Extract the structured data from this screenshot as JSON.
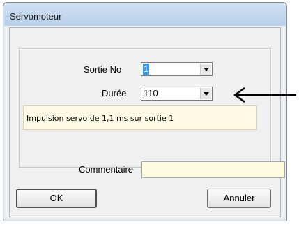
{
  "window": {
    "title": "Servomoteur"
  },
  "form": {
    "sortie_label": "Sortie No",
    "sortie_value": "1",
    "duree_label": "Durée",
    "duree_value": "110",
    "info_text": "Impulsion servo de 1,1 ms sur sortie 1",
    "commentaire_label": "Commentaire",
    "commentaire_value": ""
  },
  "buttons": {
    "ok_label": "OK",
    "annuler_label": "Annuler"
  },
  "colors": {
    "selection": "#3399ff",
    "info_background": "#fffbe6",
    "comment_background": "#fffbe1"
  }
}
